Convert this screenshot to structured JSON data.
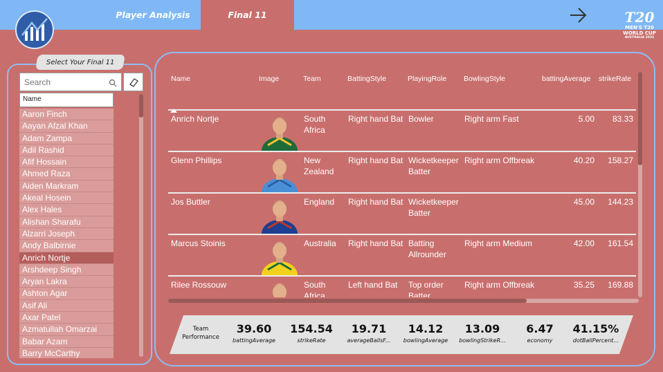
{
  "header": {
    "tabs": [
      {
        "label": "Player Analysis"
      },
      {
        "label": "Final 11"
      }
    ],
    "logo_right": {
      "line1": "T20",
      "line2": "MEN'S T20",
      "line3": "WORLD CUP",
      "line4": "AUSTRALIA 2022"
    }
  },
  "slicer": {
    "title": "Select Your Final 11",
    "search_placeholder": "Search",
    "column_header": "Name",
    "items": [
      "Aaron Finch",
      "Aayan Afzal Khan",
      "Adam Zampa",
      "Adil Rashid",
      "Afif Hossain",
      "Ahmed Raza",
      "Aiden Markram",
      "Akeal Hosein",
      "Alex Hales",
      "Alishan Sharafu",
      "Alzarri Joseph",
      "Andy Balbirnie",
      "Anrich Nortje",
      "Arshdeep Singh",
      "Aryan Lakra",
      "Ashton Agar",
      "Asif Ali",
      "Axar Patel",
      "Azmatullah Omarzai",
      "Babar Azam",
      "Barry McCarthy"
    ],
    "selected": "Anrich Nortje"
  },
  "table": {
    "columns": [
      "Name",
      "Image",
      "Team",
      "BattingStyle",
      "PlayingRole",
      "BowlingStyle",
      "battingAverage",
      "strikeRate"
    ],
    "rows": [
      {
        "name": "Anrich Nortje",
        "team1": "South",
        "team2": "Africa",
        "batting": "Right hand Bat",
        "role1": "Bowler",
        "role2": "",
        "bowling": "Right arm Fast",
        "avg": "5.00",
        "sr": "83.33",
        "kit": "#1f6b3a",
        "kit2": "#f4c430"
      },
      {
        "name": "Glenn Phillips",
        "team1": "New",
        "team2": "Zealand",
        "batting": "Right hand Bat",
        "role1": "Wicketkeeper",
        "role2": "Batter",
        "bowling": "Right arm Offbreak",
        "avg": "40.20",
        "sr": "158.27",
        "kit": "#4a8fd6",
        "kit2": "#2c5fa8"
      },
      {
        "name": "Jos Buttler",
        "team1": "England",
        "team2": "",
        "batting": "Right hand Bat",
        "role1": "Wicketkeeper",
        "role2": "Batter",
        "bowling": "",
        "avg": "45.00",
        "sr": "144.23",
        "kit": "#1e3f8f",
        "kit2": "#c0392b"
      },
      {
        "name": "Marcus Stoinis",
        "team1": "Australia",
        "team2": "",
        "batting": "Right hand Bat",
        "role1": "Batting",
        "role2": "Allrounder",
        "bowling": "Right arm Medium",
        "avg": "42.00",
        "sr": "161.54",
        "kit": "#f2d21b",
        "kit2": "#1f6b3a"
      },
      {
        "name": "Rilee Rossouw",
        "team1": "South",
        "team2": "Africa",
        "batting": "Left hand Bat",
        "role1": "Top order",
        "role2": "Batter",
        "bowling": "Right arm Offbreak",
        "avg": "35.25",
        "sr": "169.88",
        "kit": "#1f6b3a",
        "kit2": "#f4c430"
      }
    ]
  },
  "kpis": {
    "title_line1": "Team",
    "title_line2": "Performance",
    "items": [
      {
        "value": "39.60",
        "label": "battingAverage"
      },
      {
        "value": "154.54",
        "label": "strikeRate"
      },
      {
        "value": "19.71",
        "label": "averageBallsF..."
      },
      {
        "value": "14.12",
        "label": "bowlingAverage"
      },
      {
        "value": "13.09",
        "label": "bowlingStrikeR..."
      },
      {
        "value": "6.47",
        "label": "economy"
      },
      {
        "value": "41.15%",
        "label": "dotBallPercent..."
      }
    ]
  }
}
